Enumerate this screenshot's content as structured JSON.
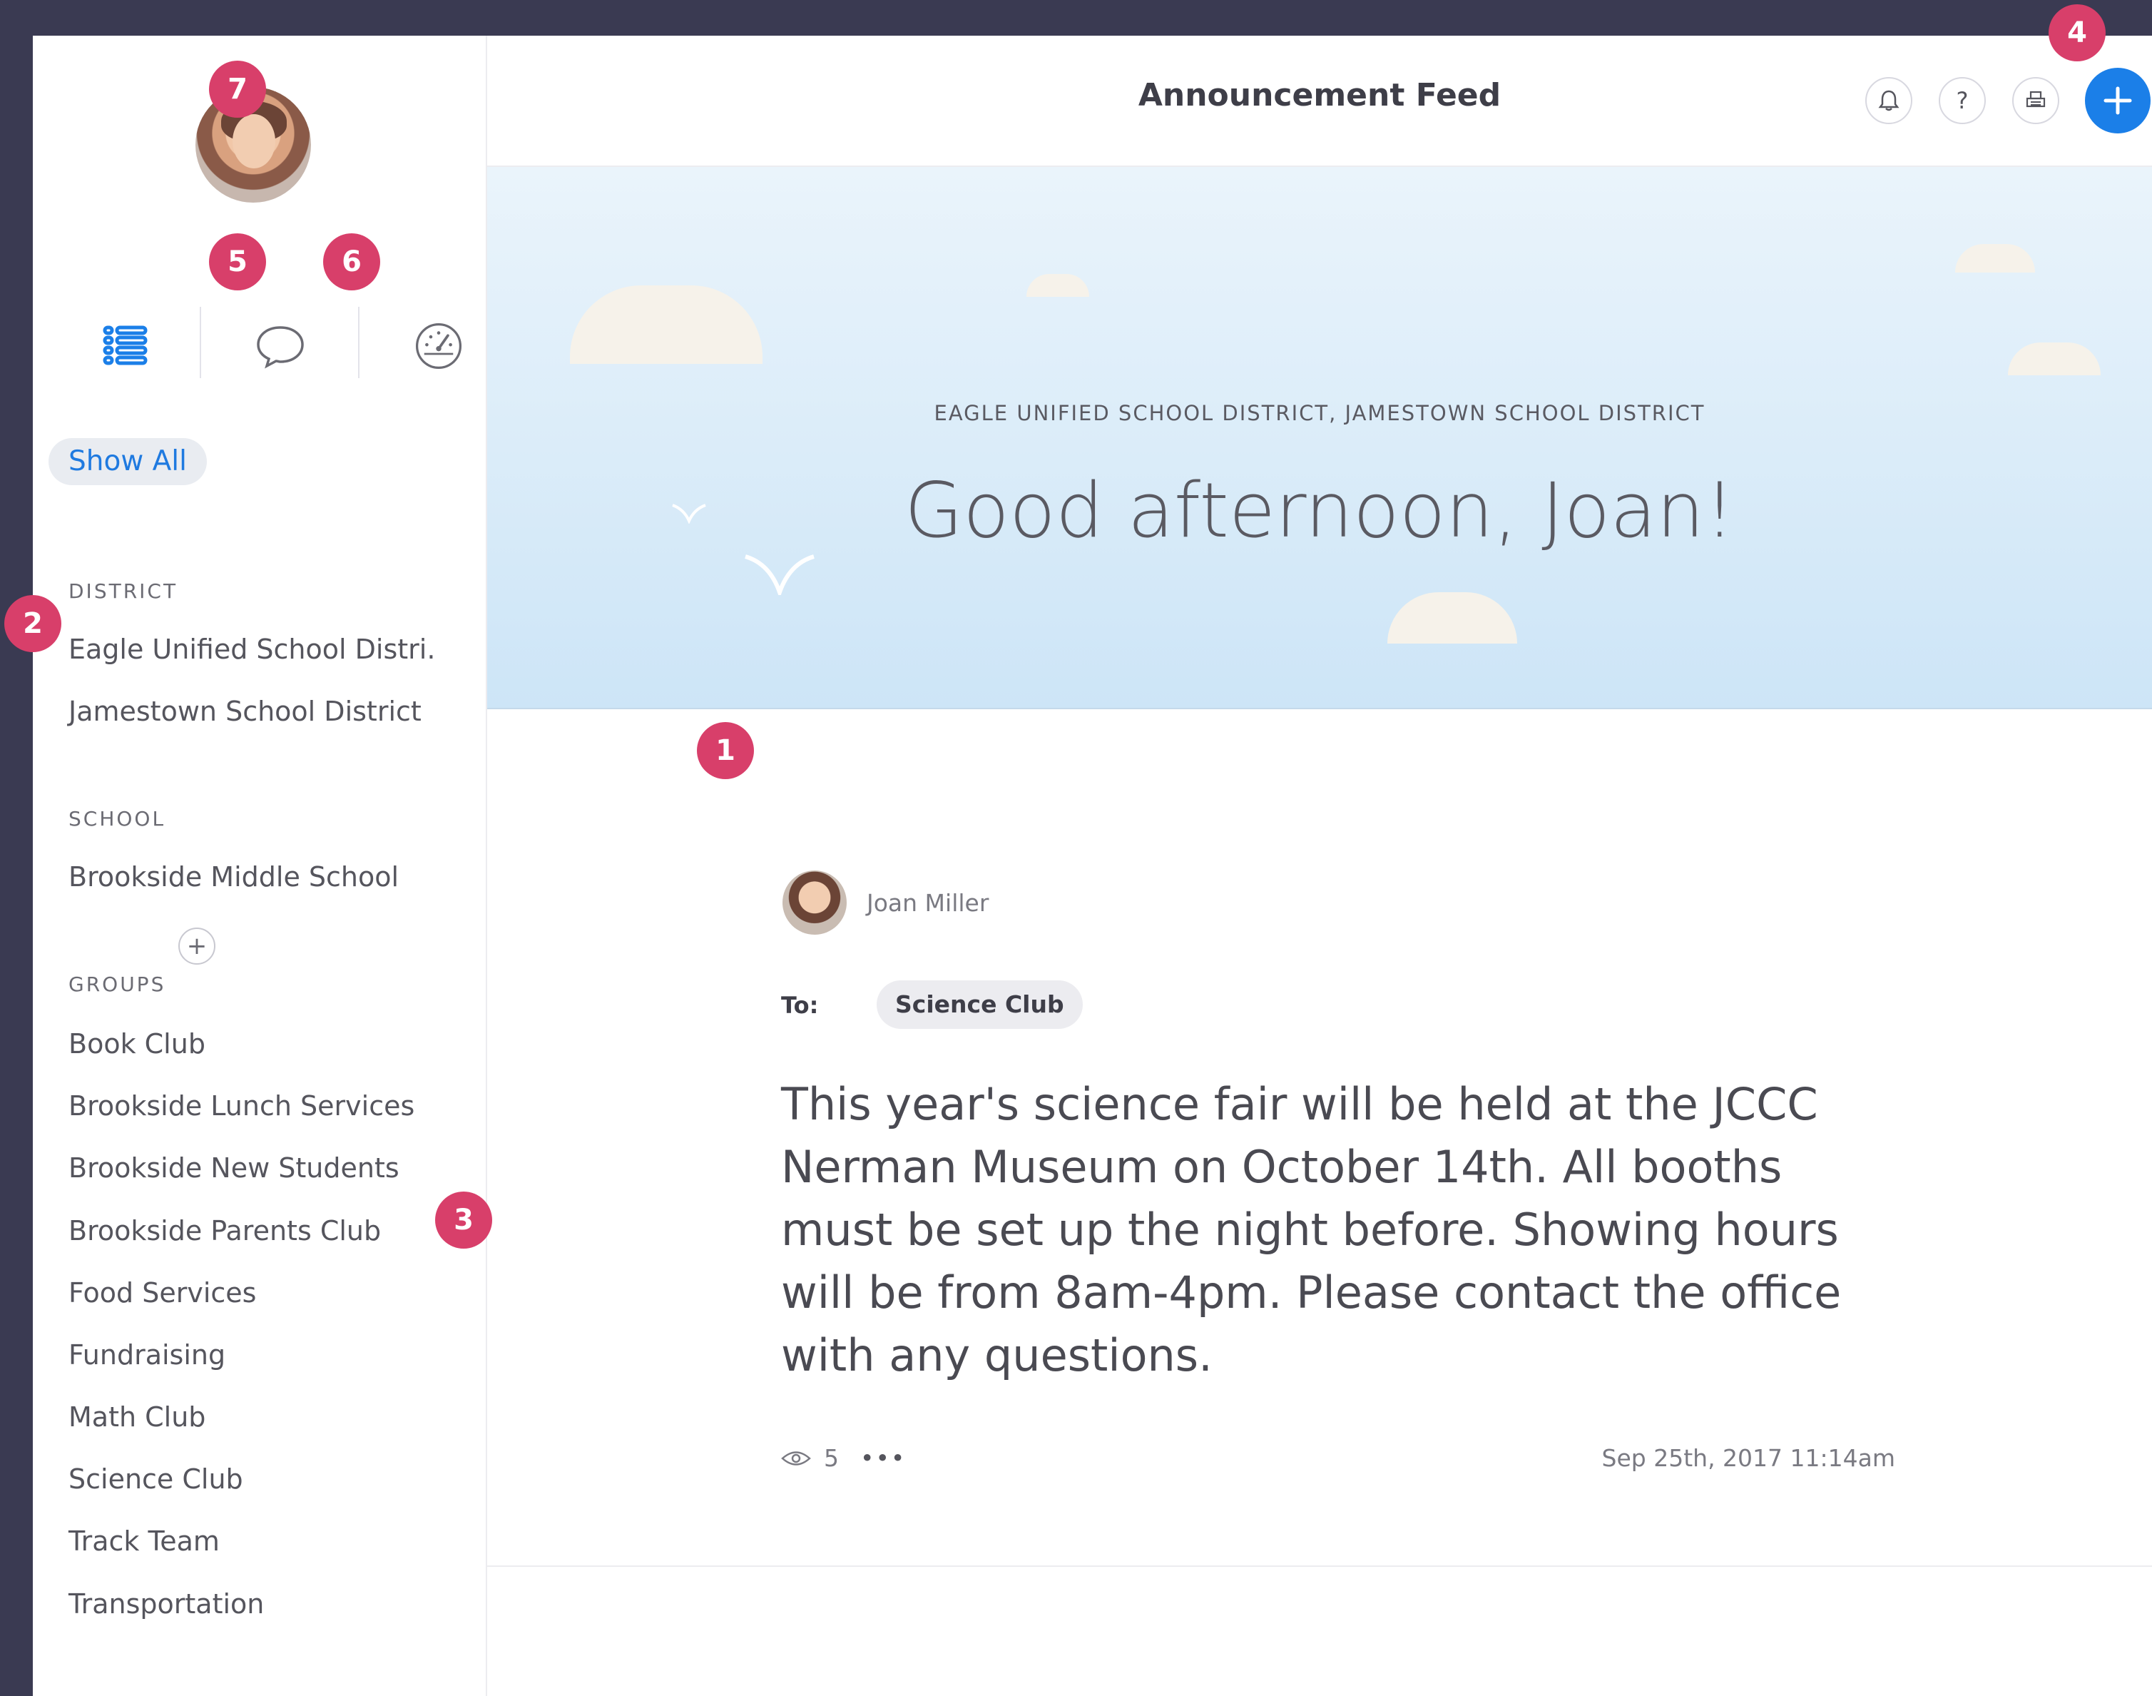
{
  "header": {
    "title": "Announcement Feed",
    "bell_icon": "bell-icon",
    "help_label": "?",
    "print_icon": "printer-icon",
    "add_icon": "plus-icon"
  },
  "sidebar": {
    "nav": [
      "list-icon",
      "chat-bubble-icon",
      "dashboard-gauge-icon"
    ],
    "show_all": "Show All",
    "district_label": "DISTRICT",
    "districts": [
      "Eagle Unified School Distri.",
      "Jamestown School District"
    ],
    "school_label": "SCHOOL",
    "schools": [
      "Brookside Middle School"
    ],
    "groups_label": "GROUPS",
    "groups_add": "+",
    "groups": [
      "Book Club",
      "Brookside Lunch Services",
      "Brookside New Students",
      "Brookside Parents Club",
      "Food Services",
      "Fundraising",
      "Math Club",
      "Science Club",
      "Track Team",
      "Transportation"
    ]
  },
  "banner": {
    "districts_line": "EAGLE UNIFIED SCHOOL DISTRICT, JAMESTOWN SCHOOL DISTRICT",
    "greeting": "Good afternoon, Joan!"
  },
  "post": {
    "author": "Joan Miller",
    "to_label": "To:",
    "recipient": "Science Club",
    "body": "This year's science fair will be held at the JCCC Nerman Museum on October 14th. All booths must be set up the night before. Showing hours will be from 8am-4pm. Please contact the office with any questions.",
    "views": "5",
    "more": "•••",
    "timestamp": "Sep 25th, 2017 11:14am"
  },
  "markers": [
    "1",
    "2",
    "3",
    "4",
    "5",
    "6",
    "7"
  ],
  "colors": {
    "accent": "#1b7fe8",
    "marker": "#d83f6a",
    "frame": "#3a3a52"
  }
}
